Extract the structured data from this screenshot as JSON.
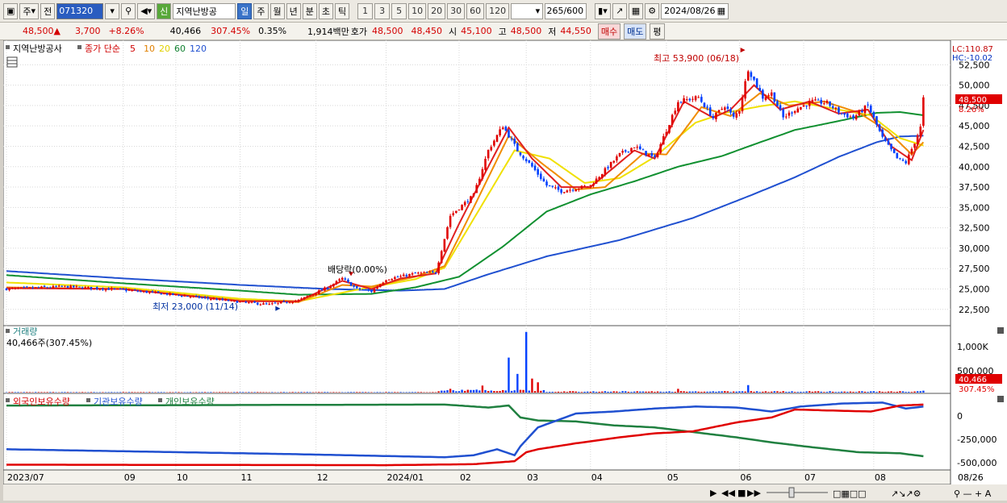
{
  "toolbar": {
    "market": "주",
    "prev": "전",
    "code": "071320",
    "badge": "신",
    "name": "지역난방공",
    "periods": [
      "일",
      "주",
      "월",
      "년",
      "분",
      "초",
      "틱"
    ],
    "intervals": [
      "1",
      "3",
      "5",
      "10",
      "20",
      "30",
      "60",
      "120"
    ],
    "count": "265",
    "count_max": "/600",
    "date": "2024/08/26"
  },
  "quote": {
    "price": "48,500",
    "change": "3,700",
    "change_pct": "+8.26%",
    "volume": "40,466",
    "volume_pct": "307.45%",
    "turnover_rate": "0.35%",
    "amount": "1,914백만",
    "hoga_label": "호가",
    "ask": "48,500",
    "bid": "48,450",
    "open_label": "시",
    "open": "45,100",
    "high_label": "고",
    "high": "48,500",
    "low_label": "저",
    "low": "44,550",
    "buy_button": "매수",
    "sell_button": "매도",
    "avg_button": "평"
  },
  "legend": {
    "name": "지역난방공사",
    "ma_label": "종가 단순",
    "ma_periods": [
      "5",
      "10",
      "20",
      "60",
      "120"
    ]
  },
  "volume_panel": {
    "title": "거래량",
    "value_label": "40,466주(307.45%)",
    "ticks": [
      "1,000K",
      "500,000"
    ],
    "last_value": "40,466",
    "last_pct": "307.45%"
  },
  "holdings_panel": {
    "series_labels": [
      "외국인보유수량",
      "기관보유수량",
      "개인보유수량"
    ],
    "ticks": [
      "0",
      "-250,000",
      "-500,000"
    ]
  },
  "annotations": {
    "high": "최고 53,900 (06/18)",
    "low": "최저 23,000 (11/14)",
    "dividend": "배당락(0.00%)",
    "lc": "LC:110.87",
    "hc": "HC:-10.02",
    "last_price": "48,500",
    "last_pct": "8.26%"
  },
  "colors": {
    "up": "#e00000",
    "down": "#0040ff",
    "ma5": "#e02020",
    "ma10": "#f08c00",
    "ma20": "#f0e000",
    "ma60": "#109030",
    "ma120": "#2050d0",
    "foreign": "#e00000",
    "institution": "#2050d0",
    "individual": "#208040"
  },
  "chart_data": {
    "type": "line",
    "title": "지역난방공사",
    "y_ticks": [
      "52,500",
      "50,000",
      "47,500",
      "45,000",
      "42,500",
      "40,000",
      "37,500",
      "35,000",
      "32,500",
      "30,000",
      "27,500",
      "25,000",
      "22,500"
    ],
    "ylim": [
      20800,
      55200
    ],
    "x_labels": [
      "2023/07",
      "09",
      "10",
      "11",
      "12",
      "2024/01",
      "02",
      "03",
      "04",
      "05",
      "06",
      "07",
      "08",
      "08/26"
    ],
    "n_bars": 265,
    "x_label_index": [
      0,
      40,
      58,
      80,
      106,
      130,
      155,
      178,
      200,
      226,
      251,
      273,
      297,
      264
    ],
    "close_anchors": [
      [
        0,
        25000
      ],
      [
        20,
        25300
      ],
      [
        40,
        24900
      ],
      [
        60,
        24200
      ],
      [
        80,
        23400
      ],
      [
        90,
        23100
      ],
      [
        100,
        23600
      ],
      [
        110,
        25200
      ],
      [
        115,
        26300
      ],
      [
        120,
        25000
      ],
      [
        125,
        24700
      ],
      [
        130,
        26200
      ],
      [
        140,
        26900
      ],
      [
        147,
        27000
      ],
      [
        152,
        34000
      ],
      [
        160,
        36500
      ],
      [
        165,
        42000
      ],
      [
        170,
        45000
      ],
      [
        175,
        42000
      ],
      [
        180,
        40000
      ],
      [
        185,
        37700
      ],
      [
        190,
        37000
      ],
      [
        200,
        37700
      ],
      [
        210,
        41500
      ],
      [
        215,
        42500
      ],
      [
        222,
        41000
      ],
      [
        230,
        48000
      ],
      [
        237,
        48500
      ],
      [
        242,
        46000
      ],
      [
        246,
        47500
      ],
      [
        249,
        46000
      ],
      [
        251,
        47000
      ],
      [
        254,
        52000
      ],
      [
        259,
        48500
      ],
      [
        262,
        49000
      ],
      [
        266,
        46000
      ],
      [
        270,
        47000
      ],
      [
        276,
        48000
      ],
      [
        281,
        47800
      ],
      [
        286,
        46500
      ],
      [
        290,
        46000
      ],
      [
        295,
        47500
      ],
      [
        300,
        43500
      ],
      [
        305,
        41000
      ],
      [
        308,
        40500
      ],
      [
        311,
        43000
      ],
      [
        313,
        44800
      ],
      [
        314,
        48500
      ]
    ],
    "ma5_anchors": [
      [
        0,
        25100
      ],
      [
        40,
        25000
      ],
      [
        80,
        23500
      ],
      [
        100,
        23500
      ],
      [
        115,
        26000
      ],
      [
        125,
        25000
      ],
      [
        135,
        26300
      ],
      [
        147,
        26900
      ],
      [
        155,
        33000
      ],
      [
        165,
        40000
      ],
      [
        172,
        44800
      ],
      [
        180,
        41000
      ],
      [
        190,
        37500
      ],
      [
        200,
        37500
      ],
      [
        215,
        42000
      ],
      [
        222,
        41000
      ],
      [
        232,
        48000
      ],
      [
        242,
        46000
      ],
      [
        248,
        47000
      ],
      [
        256,
        50000
      ],
      [
        265,
        47000
      ],
      [
        275,
        48000
      ],
      [
        285,
        46500
      ],
      [
        295,
        47000
      ],
      [
        303,
        42500
      ],
      [
        310,
        40800
      ],
      [
        314,
        44500
      ]
    ],
    "ma10_anchors": [
      [
        0,
        25200
      ],
      [
        40,
        25000
      ],
      [
        80,
        23600
      ],
      [
        100,
        23400
      ],
      [
        115,
        25500
      ],
      [
        125,
        25300
      ],
      [
        140,
        26500
      ],
      [
        150,
        27800
      ],
      [
        160,
        35000
      ],
      [
        172,
        43800
      ],
      [
        183,
        40500
      ],
      [
        195,
        37200
      ],
      [
        205,
        37500
      ],
      [
        218,
        41600
      ],
      [
        226,
        41500
      ],
      [
        238,
        47300
      ],
      [
        248,
        46200
      ],
      [
        258,
        49000
      ],
      [
        268,
        47500
      ],
      [
        280,
        48000
      ],
      [
        292,
        46600
      ],
      [
        302,
        44300
      ],
      [
        310,
        41500
      ],
      [
        314,
        43000
      ]
    ],
    "ma20_anchors": [
      [
        0,
        25800
      ],
      [
        40,
        25200
      ],
      [
        80,
        23800
      ],
      [
        100,
        23500
      ],
      [
        120,
        24900
      ],
      [
        140,
        26200
      ],
      [
        150,
        27600
      ],
      [
        162,
        34800
      ],
      [
        174,
        42000
      ],
      [
        186,
        41000
      ],
      [
        198,
        38000
      ],
      [
        210,
        38600
      ],
      [
        222,
        41200
      ],
      [
        236,
        45400
      ],
      [
        246,
        46600
      ],
      [
        258,
        47400
      ],
      [
        270,
        48000
      ],
      [
        285,
        47000
      ],
      [
        296,
        46300
      ],
      [
        306,
        43500
      ],
      [
        314,
        42600
      ]
    ],
    "ma60_anchors": [
      [
        0,
        26700
      ],
      [
        40,
        25700
      ],
      [
        80,
        24800
      ],
      [
        100,
        24300
      ],
      [
        125,
        24400
      ],
      [
        140,
        25200
      ],
      [
        155,
        26500
      ],
      [
        170,
        30200
      ],
      [
        185,
        34500
      ],
      [
        200,
        36600
      ],
      [
        215,
        38200
      ],
      [
        230,
        40000
      ],
      [
        245,
        41300
      ],
      [
        255,
        42600
      ],
      [
        270,
        44500
      ],
      [
        285,
        45600
      ],
      [
        298,
        46600
      ],
      [
        306,
        46700
      ],
      [
        314,
        46300
      ]
    ],
    "ma120_anchors": [
      [
        0,
        27200
      ],
      [
        40,
        26300
      ],
      [
        80,
        25500
      ],
      [
        110,
        25000
      ],
      [
        135,
        24800
      ],
      [
        150,
        25000
      ],
      [
        165,
        26800
      ],
      [
        185,
        29000
      ],
      [
        210,
        31000
      ],
      [
        235,
        33700
      ],
      [
        255,
        36500
      ],
      [
        270,
        38700
      ],
      [
        285,
        41200
      ],
      [
        298,
        43000
      ],
      [
        306,
        43700
      ],
      [
        314,
        43800
      ]
    ],
    "volume_ylim": [
      0,
      1400000
    ],
    "volume_spikes": [
      [
        152,
        80000
      ],
      [
        163,
        150000
      ],
      [
        172,
        750000
      ],
      [
        175,
        400000
      ],
      [
        178,
        1300000
      ],
      [
        180,
        300000
      ],
      [
        182,
        220000
      ],
      [
        230,
        80000
      ],
      [
        254,
        160000
      ],
      [
        314,
        40466
      ]
    ],
    "holdings_ylim": [
      -620000,
      110000
    ],
    "foreign_anchors": [
      [
        0,
        -575000
      ],
      [
        130,
        -580000
      ],
      [
        160,
        -570000
      ],
      [
        174,
        -540000
      ],
      [
        178,
        -450000
      ],
      [
        182,
        -420000
      ],
      [
        195,
        -360000
      ],
      [
        210,
        -300000
      ],
      [
        222,
        -260000
      ],
      [
        235,
        -240000
      ],
      [
        250,
        -150000
      ],
      [
        262,
        -100000
      ],
      [
        270,
        -20000
      ],
      [
        282,
        -30000
      ],
      [
        296,
        -40000
      ],
      [
        306,
        20000
      ],
      [
        314,
        30000
      ]
    ],
    "institution_anchors": [
      [
        0,
        -420000
      ],
      [
        100,
        -470000
      ],
      [
        150,
        -500000
      ],
      [
        160,
        -480000
      ],
      [
        168,
        -420000
      ],
      [
        174,
        -480000
      ],
      [
        176,
        -390000
      ],
      [
        182,
        -200000
      ],
      [
        195,
        -60000
      ],
      [
        208,
        -40000
      ],
      [
        222,
        -10000
      ],
      [
        236,
        10000
      ],
      [
        250,
        0
      ],
      [
        262,
        -40000
      ],
      [
        272,
        10000
      ],
      [
        286,
        40000
      ],
      [
        300,
        50000
      ],
      [
        308,
        -10000
      ],
      [
        314,
        10000
      ]
    ],
    "individual_anchors": [
      [
        0,
        20000
      ],
      [
        150,
        30000
      ],
      [
        165,
        0
      ],
      [
        172,
        20000
      ],
      [
        176,
        -100000
      ],
      [
        182,
        -130000
      ],
      [
        195,
        -140000
      ],
      [
        208,
        -180000
      ],
      [
        222,
        -200000
      ],
      [
        236,
        -250000
      ],
      [
        250,
        -300000
      ],
      [
        262,
        -350000
      ],
      [
        276,
        -400000
      ],
      [
        292,
        -450000
      ],
      [
        306,
        -460000
      ],
      [
        314,
        -490000
      ]
    ]
  }
}
